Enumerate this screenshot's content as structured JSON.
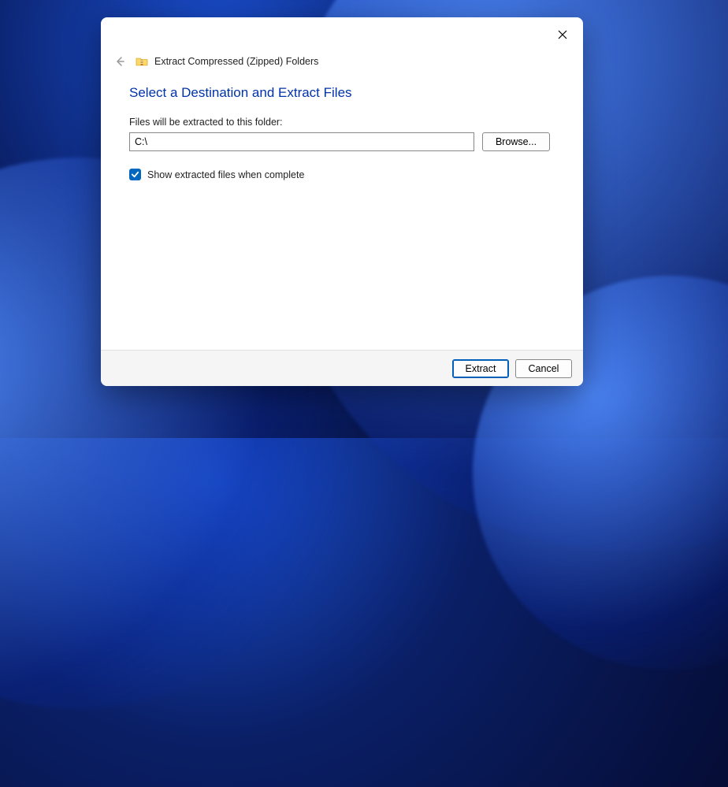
{
  "dialog": {
    "window_title": "Extract Compressed (Zipped) Folders",
    "heading": "Select a Destination and Extract Files",
    "path_label": "Files will be extracted to this folder:",
    "path_value": "C:\\",
    "browse_label": "Browse...",
    "checkbox_label": "Show extracted files when complete",
    "checkbox_checked": true,
    "extract_label": "Extract",
    "cancel_label": "Cancel"
  }
}
